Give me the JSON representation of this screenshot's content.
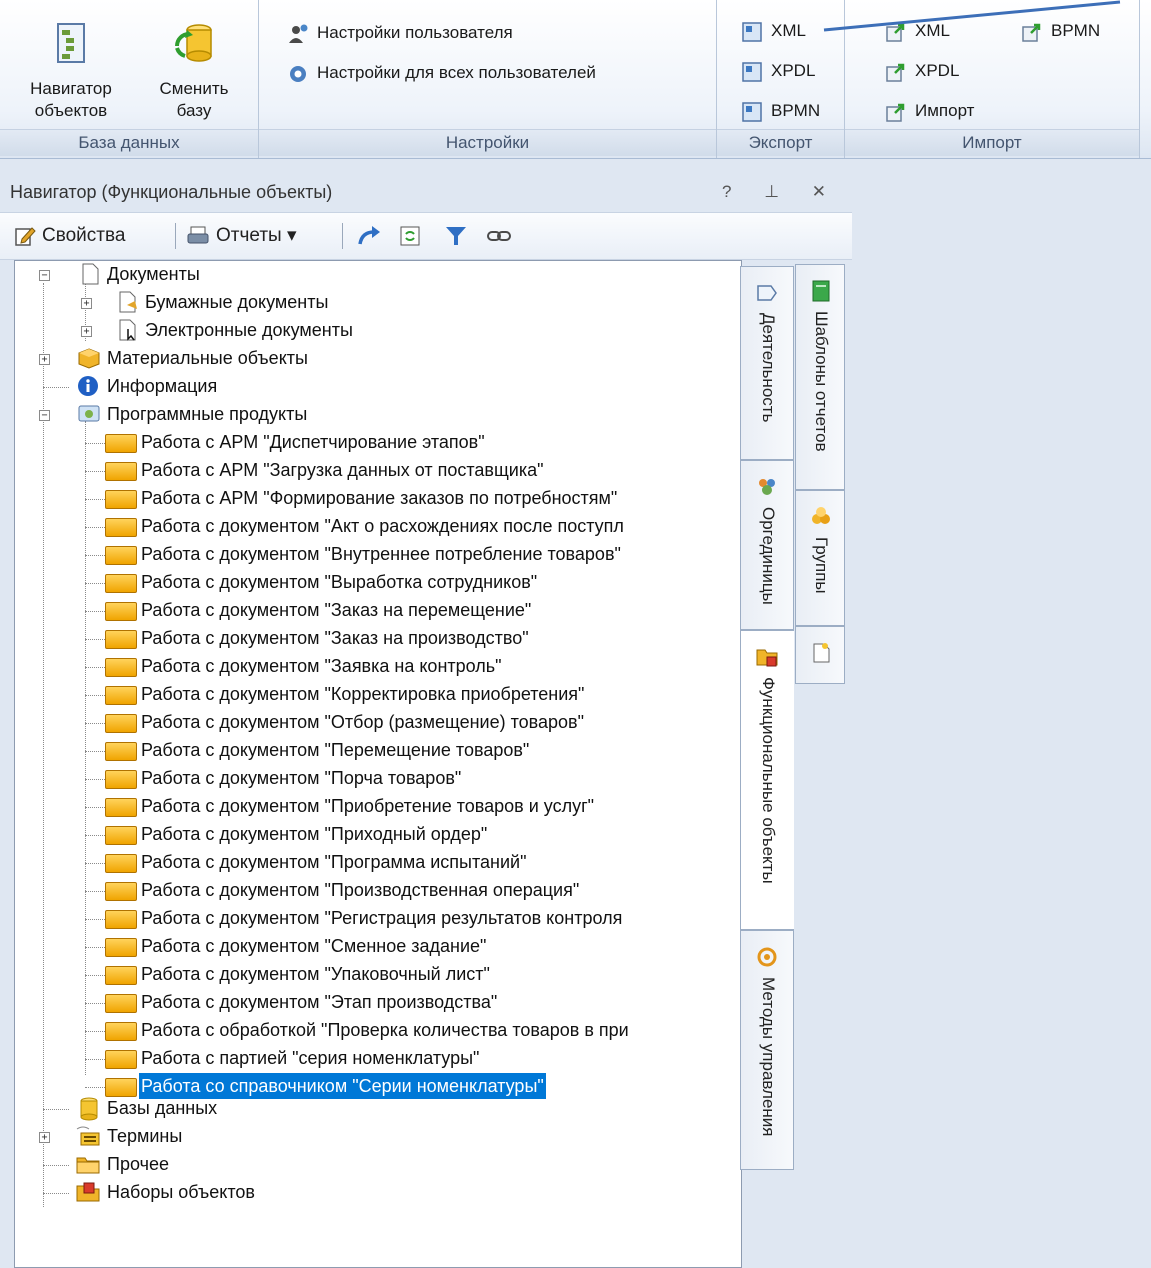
{
  "ribbon": {
    "db_group": {
      "label": "База данных",
      "navigator_line1": "Навигатор",
      "navigator_line2": "объектов",
      "switch_line1": "Сменить",
      "switch_line2": "базу"
    },
    "settings_group": {
      "label": "Настройки",
      "user_settings": "Настройки пользователя",
      "all_users_settings": "Настройки для всех пользователей"
    },
    "export_group": {
      "label": "Экспорт",
      "xml": "XML",
      "xpdl": "XPDL",
      "bpmn": "BPMN"
    },
    "import_group": {
      "label": "Импорт",
      "xml": "XML",
      "xpdl": "XPDL",
      "import": "Импорт",
      "bpmn": "BPMN"
    }
  },
  "panel": {
    "title": "Навигатор (Функциональные объекты)",
    "controls": "? ⊥ ✕",
    "toolbar": {
      "properties": "Свойства",
      "reports": "Отчеты ▾"
    }
  },
  "tree": {
    "documents": "Документы",
    "paper_docs": "Бумажные документы",
    "electronic_docs": "Электронные документы",
    "material_objects": "Материальные объекты",
    "information": "Информация",
    "software": "Программные продукты",
    "software_items": [
      "Работа с АРМ \"Диспетчирование этапов\"",
      "Работа с АРМ \"Загрузка данных от поставщика\"",
      "Работа с АРМ \"Формирование заказов по потребностям\"",
      "Работа с документом \"Акт о расхождениях после поступл",
      "Работа с документом \"Внутреннее потребление товаров\"",
      "Работа с документом \"Выработка сотрудников\"",
      "Работа с документом \"Заказ на перемещение\"",
      "Работа с документом \"Заказ на производство\"",
      "Работа с документом \"Заявка на контроль\"",
      "Работа с документом \"Корректировка приобретения\"",
      "Работа с документом \"Отбор (размещение) товаров\"",
      "Работа с документом \"Перемещение товаров\"",
      "Работа с документом \"Порча товаров\"",
      "Работа с документом \"Приобретение товаров и услуг\"",
      "Работа с документом \"Приходный ордер\"",
      "Работа с документом \"Программа испытаний\"",
      "Работа с документом \"Производственная операция\"",
      "Работа с документом \"Регистрация результатов контроля",
      "Работа с документом \"Сменное задание\"",
      "Работа с документом \"Упаковочный лист\"",
      "Работа с документом \"Этап производства\"",
      "Работа с обработкой \"Проверка количества товаров в при",
      "Работа с партией \"серия номенклатуры\"",
      "Работа со справочником \"Серии номенклатуры\""
    ],
    "databases": "Базы данных",
    "terms": "Термины",
    "other": "Прочее",
    "object_sets": "Наборы объектов"
  },
  "side_tabs": {
    "activity": "Деятельность",
    "org_units": "Оргединицы",
    "functional_objects": "Функциональные объекты",
    "management_methods": "Методы управления",
    "report_templates": "Шаблоны отчетов",
    "groups": "Группы"
  },
  "colors": {
    "selection": "#0078d7",
    "folder": "#f0a400",
    "ribbon_label": "#44556f"
  }
}
